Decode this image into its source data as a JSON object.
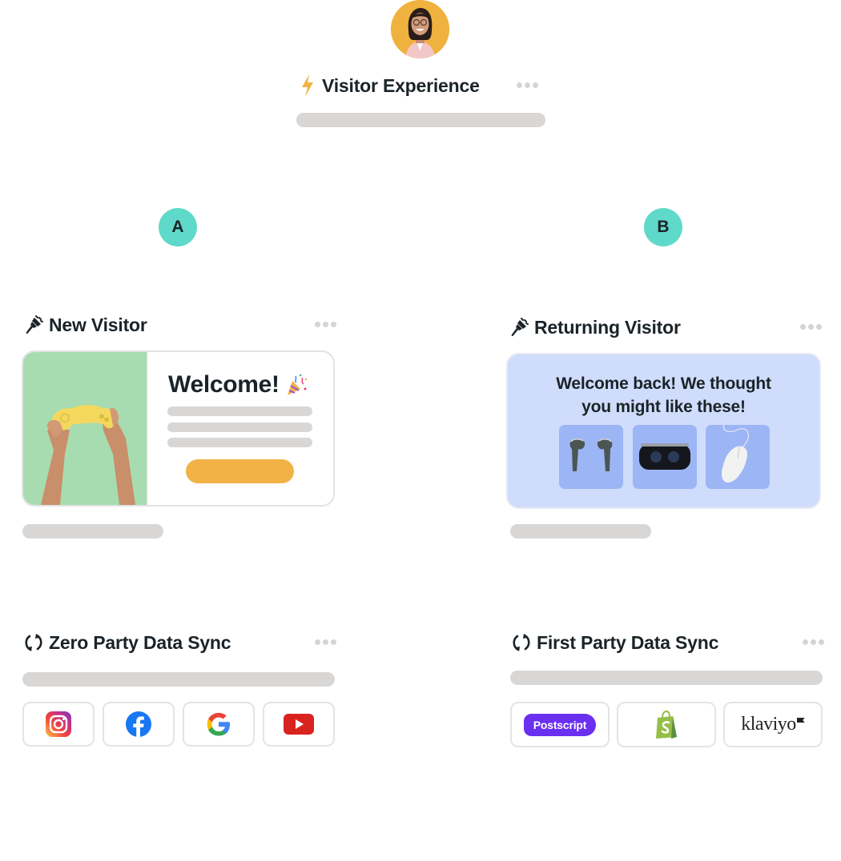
{
  "root": {
    "title": "Visitor Experience",
    "icon": "lightning-bolt-icon",
    "avatar": "person-avatar",
    "more_icon": "more-dots-icon"
  },
  "branches": [
    {
      "badge": "A",
      "title": "New Visitor",
      "icon": "paintbrush-icon",
      "card": {
        "heading": "Welcome!",
        "emoji_icon": "party-popper-icon",
        "image": "hands-holding-game-controller",
        "image_bg": "#a7dcb1",
        "button_color": "#f2b246"
      }
    },
    {
      "badge": "B",
      "title": "Returning Visitor",
      "icon": "paintbrush-icon",
      "card": {
        "heading": "Welcome back! We thought you might like these!",
        "bg": "#d0dcfb",
        "products": [
          "earbuds",
          "vr-headset",
          "computer-mouse"
        ]
      }
    }
  ],
  "syncs": [
    {
      "title": "Zero Party Data Sync",
      "icon": "sync-icon",
      "logos": [
        "instagram",
        "facebook",
        "google",
        "youtube"
      ]
    },
    {
      "title": "First Party Data Sync",
      "icon": "sync-icon",
      "logos": [
        {
          "name": "postscript",
          "label": "Postscript"
        },
        {
          "name": "shopify",
          "label": ""
        },
        {
          "name": "klaviyo",
          "label": "klaviyo"
        }
      ]
    }
  ],
  "colors": {
    "badge": "#5fd9c9",
    "placeholder": "#d8d7d5",
    "text": "#1a2328",
    "avatar_bg": "#f0b23e"
  }
}
